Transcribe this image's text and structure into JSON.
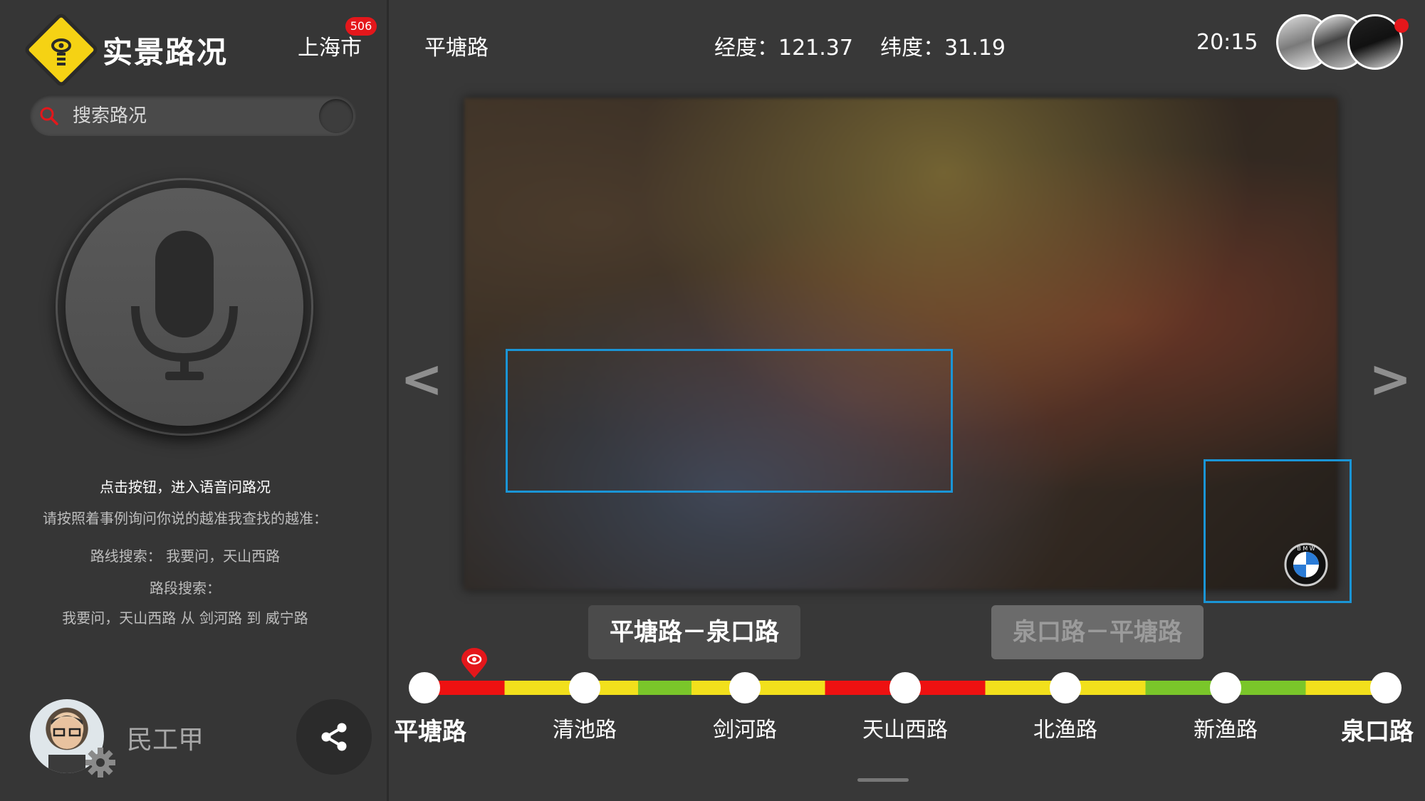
{
  "app": {
    "title": "实景路况",
    "city": "上海市",
    "city_badge": "506"
  },
  "search": {
    "placeholder": "搜索路况"
  },
  "voice": {
    "hint_primary": "点击按钮，进入语音问路况",
    "hint_secondary": "请按照着事例询问你说的越准我查找的越准：",
    "example_route": "路线搜索：   我要问，天山西路",
    "example_segment_label": "路段搜索：",
    "example_segment": "我要问，天山西路 从 剑河路 到 威宁路"
  },
  "user": {
    "name": "民工甲"
  },
  "header": {
    "road": "平塘路",
    "coords": "经度：121.37    纬度：31.19",
    "time": "20:15"
  },
  "nav": {
    "prev": "<",
    "next": ">"
  },
  "segments": {
    "active": "平塘路－泉口路",
    "inactive": "泉口路－平塘路"
  },
  "route": {
    "stops": [
      "平塘路",
      "清池路",
      "剑河路",
      "天山西路",
      "北渔路",
      "新渔路",
      "泉口路"
    ],
    "traffic": [
      [
        "red",
        "yellow"
      ],
      [
        "yellow",
        "green",
        "yellow"
      ],
      [
        "yellow",
        "red"
      ],
      [
        "red",
        "yellow"
      ],
      [
        "yellow",
        "green"
      ],
      [
        "green",
        "yellow"
      ]
    ],
    "current_stop_index": 0
  },
  "colors": {
    "accent": "#f5d214",
    "badge": "#e4171b",
    "highlight_box": "#1a95d6",
    "traffic_red": "#ee1111",
    "traffic_yellow": "#f2e01c",
    "traffic_green": "#7ac62a"
  },
  "icons": {
    "logo": "road-eye-logo-icon",
    "search": "search-icon",
    "mic": "microphone-icon",
    "settings": "gear-icon",
    "share": "share-icon",
    "location": "location-pin-icon",
    "brand": "bmw-logo-icon"
  }
}
